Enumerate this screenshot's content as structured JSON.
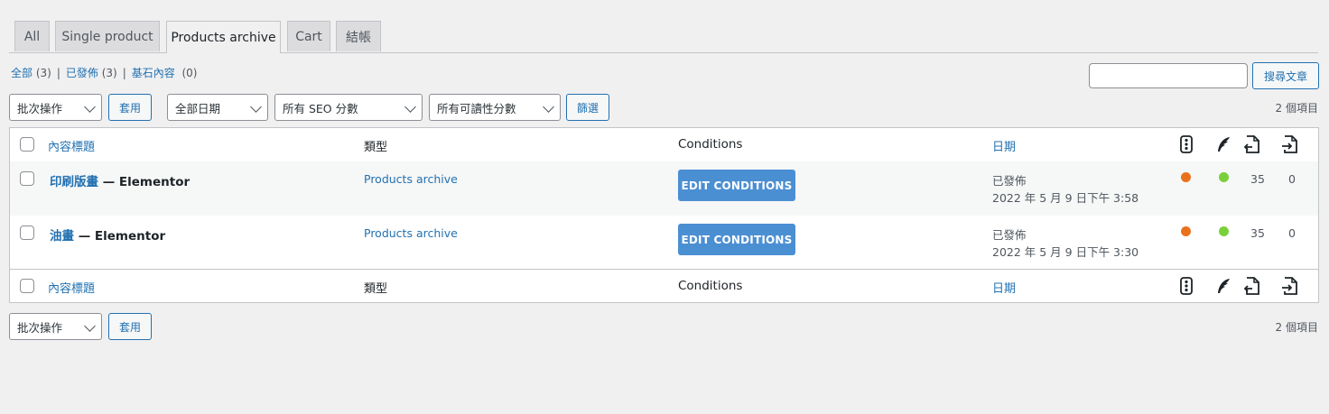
{
  "tabs": [
    {
      "label": "All",
      "active": false
    },
    {
      "label": "Single product",
      "active": false
    },
    {
      "label": "Products archive",
      "active": true
    },
    {
      "label": "Cart",
      "active": false
    },
    {
      "label": "結帳",
      "active": false
    }
  ],
  "views": {
    "all_label": "全部",
    "all_count": "(3)",
    "published_label": "已發佈",
    "published_count": "(3)",
    "cornerstone_label": "基石內容",
    "cornerstone_count": "(0)",
    "separator": "|"
  },
  "search": {
    "button_label": "搜尋文章",
    "value": ""
  },
  "bulk_actions": {
    "label": "批次操作",
    "apply_label": "套用"
  },
  "filters": {
    "date": "全部日期",
    "seo": "所有 SEO 分數",
    "readability": "所有可讀性分數",
    "filter_label": "篩選"
  },
  "items_count": "2 個項目",
  "columns": {
    "title": "內容標題",
    "type": "類型",
    "conditions": "Conditions",
    "date": "日期",
    "icons": [
      "seo-score-icon",
      "readability-icon",
      "outgoing-links-icon",
      "incoming-links-icon"
    ]
  },
  "rows": [
    {
      "title_link": "印刷版畫",
      "title_suffix": " — Elementor",
      "type": "Products archive",
      "conditions_button": "EDIT CONDITIONS",
      "status": "已發佈",
      "date": "2022 年 5 月 9 日下午 3:58",
      "seo_color": "#e9711c",
      "readability_color": "#7ad03a",
      "outgoing_links": "35",
      "incoming_links": "0"
    },
    {
      "title_link": "油畫",
      "title_suffix": " — Elementor",
      "type": "Products archive",
      "conditions_button": "EDIT CONDITIONS",
      "status": "已發佈",
      "date": "2022 年 5 月 9 日下午 3:30",
      "seo_color": "#e9711c",
      "readability_color": "#7ad03a",
      "outgoing_links": "35",
      "incoming_links": "0"
    }
  ],
  "colors": {
    "accent": "#2271b1",
    "button": "#4b8fd3",
    "background": "#f0f0f1"
  }
}
